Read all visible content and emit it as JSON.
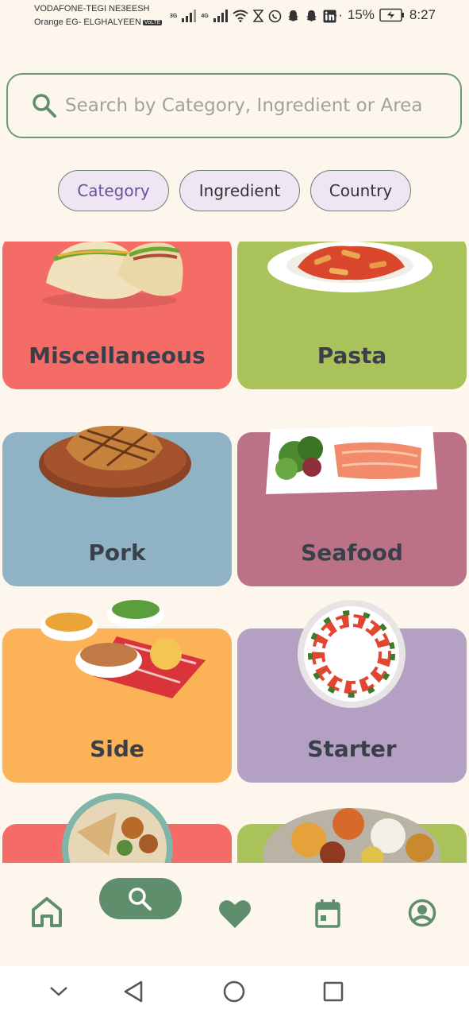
{
  "status_bar": {
    "carrier_1": "VODAFONE-TEGI NE3EESH",
    "carrier_2": "Orange EG- ELGHALYEEN",
    "volte": "VoLTE",
    "net_1": "3G",
    "net_2": "4G",
    "dots": "··",
    "battery": "15%",
    "time": "8:27"
  },
  "search": {
    "placeholder": "Search by Category, Ingredient or Area"
  },
  "filters": [
    {
      "label": "Category",
      "selected": true
    },
    {
      "label": "Ingredient",
      "selected": false
    },
    {
      "label": "Country",
      "selected": false
    }
  ],
  "categories": [
    {
      "label": "Miscellaneous",
      "color": "#F56B66"
    },
    {
      "label": "Pasta",
      "color": "#A9C25A"
    },
    {
      "label": "Pork",
      "color": "#8FB3C4"
    },
    {
      "label": "Seafood",
      "color": "#BB7186"
    },
    {
      "label": "Side",
      "color": "#FCB257"
    },
    {
      "label": "Starter",
      "color": "#B3A0C3"
    },
    {
      "label": "",
      "color": "#F56B66"
    },
    {
      "label": "",
      "color": "#A9C25A"
    }
  ],
  "bottom_nav": {
    "items": [
      "home-icon",
      "search-icon",
      "heart-icon",
      "calendar-icon",
      "account-icon"
    ],
    "accent": "#5F8E6D"
  },
  "system_nav": [
    "chevron-down-icon",
    "back-icon",
    "home-circle-icon",
    "recents-icon"
  ]
}
